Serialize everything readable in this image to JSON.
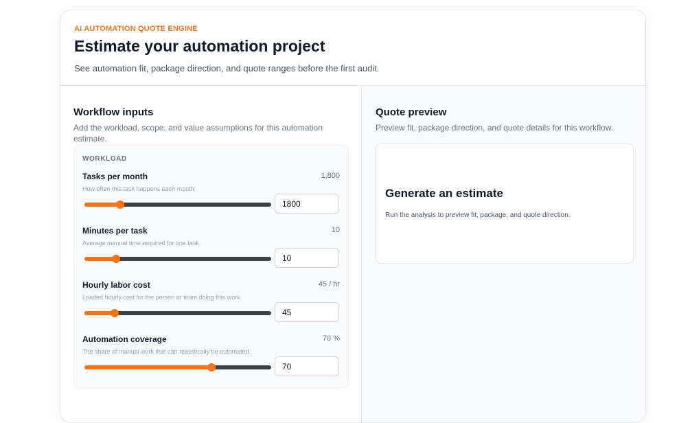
{
  "header": {
    "eyebrow": "AI AUTOMATION QUOTE ENGINE",
    "title": "Estimate your automation project",
    "subtitle": "See automation fit, package direction, and quote ranges before the first audit."
  },
  "inputs": {
    "title": "Workflow inputs",
    "description": "Add the workload, scope, and value assumptions for this automation estimate.",
    "workload": {
      "label": "WORKLOAD",
      "fields": [
        {
          "label": "Tasks per month",
          "value_display": "1,800",
          "help": "How often this task happens each month.",
          "input_value": "1800",
          "level": 0.19
        },
        {
          "label": "Minutes per task",
          "value_display": "10",
          "help": "Average manual time required for one task.",
          "input_value": "10",
          "level": 0.17
        },
        {
          "label": "Hourly labor cost",
          "value_display": "45 / hr",
          "help": "Loaded hourly cost for the person or team doing this work.",
          "input_value": "45",
          "level": 0.16
        },
        {
          "label": "Automation coverage",
          "value_display": "70 %",
          "help": "The share of manual work that can realistically be automated.",
          "input_value": "70",
          "level": 0.68
        }
      ]
    }
  },
  "preview": {
    "title": "Quote preview",
    "description": "Preview fit, package direction, and quote details for this workflow.",
    "empty_title": "Generate an estimate",
    "empty_desc": "Run the analysis to preview fit, package, and quote direction."
  },
  "colors": {
    "accent": "#f97316",
    "track": "#3f3f46"
  }
}
